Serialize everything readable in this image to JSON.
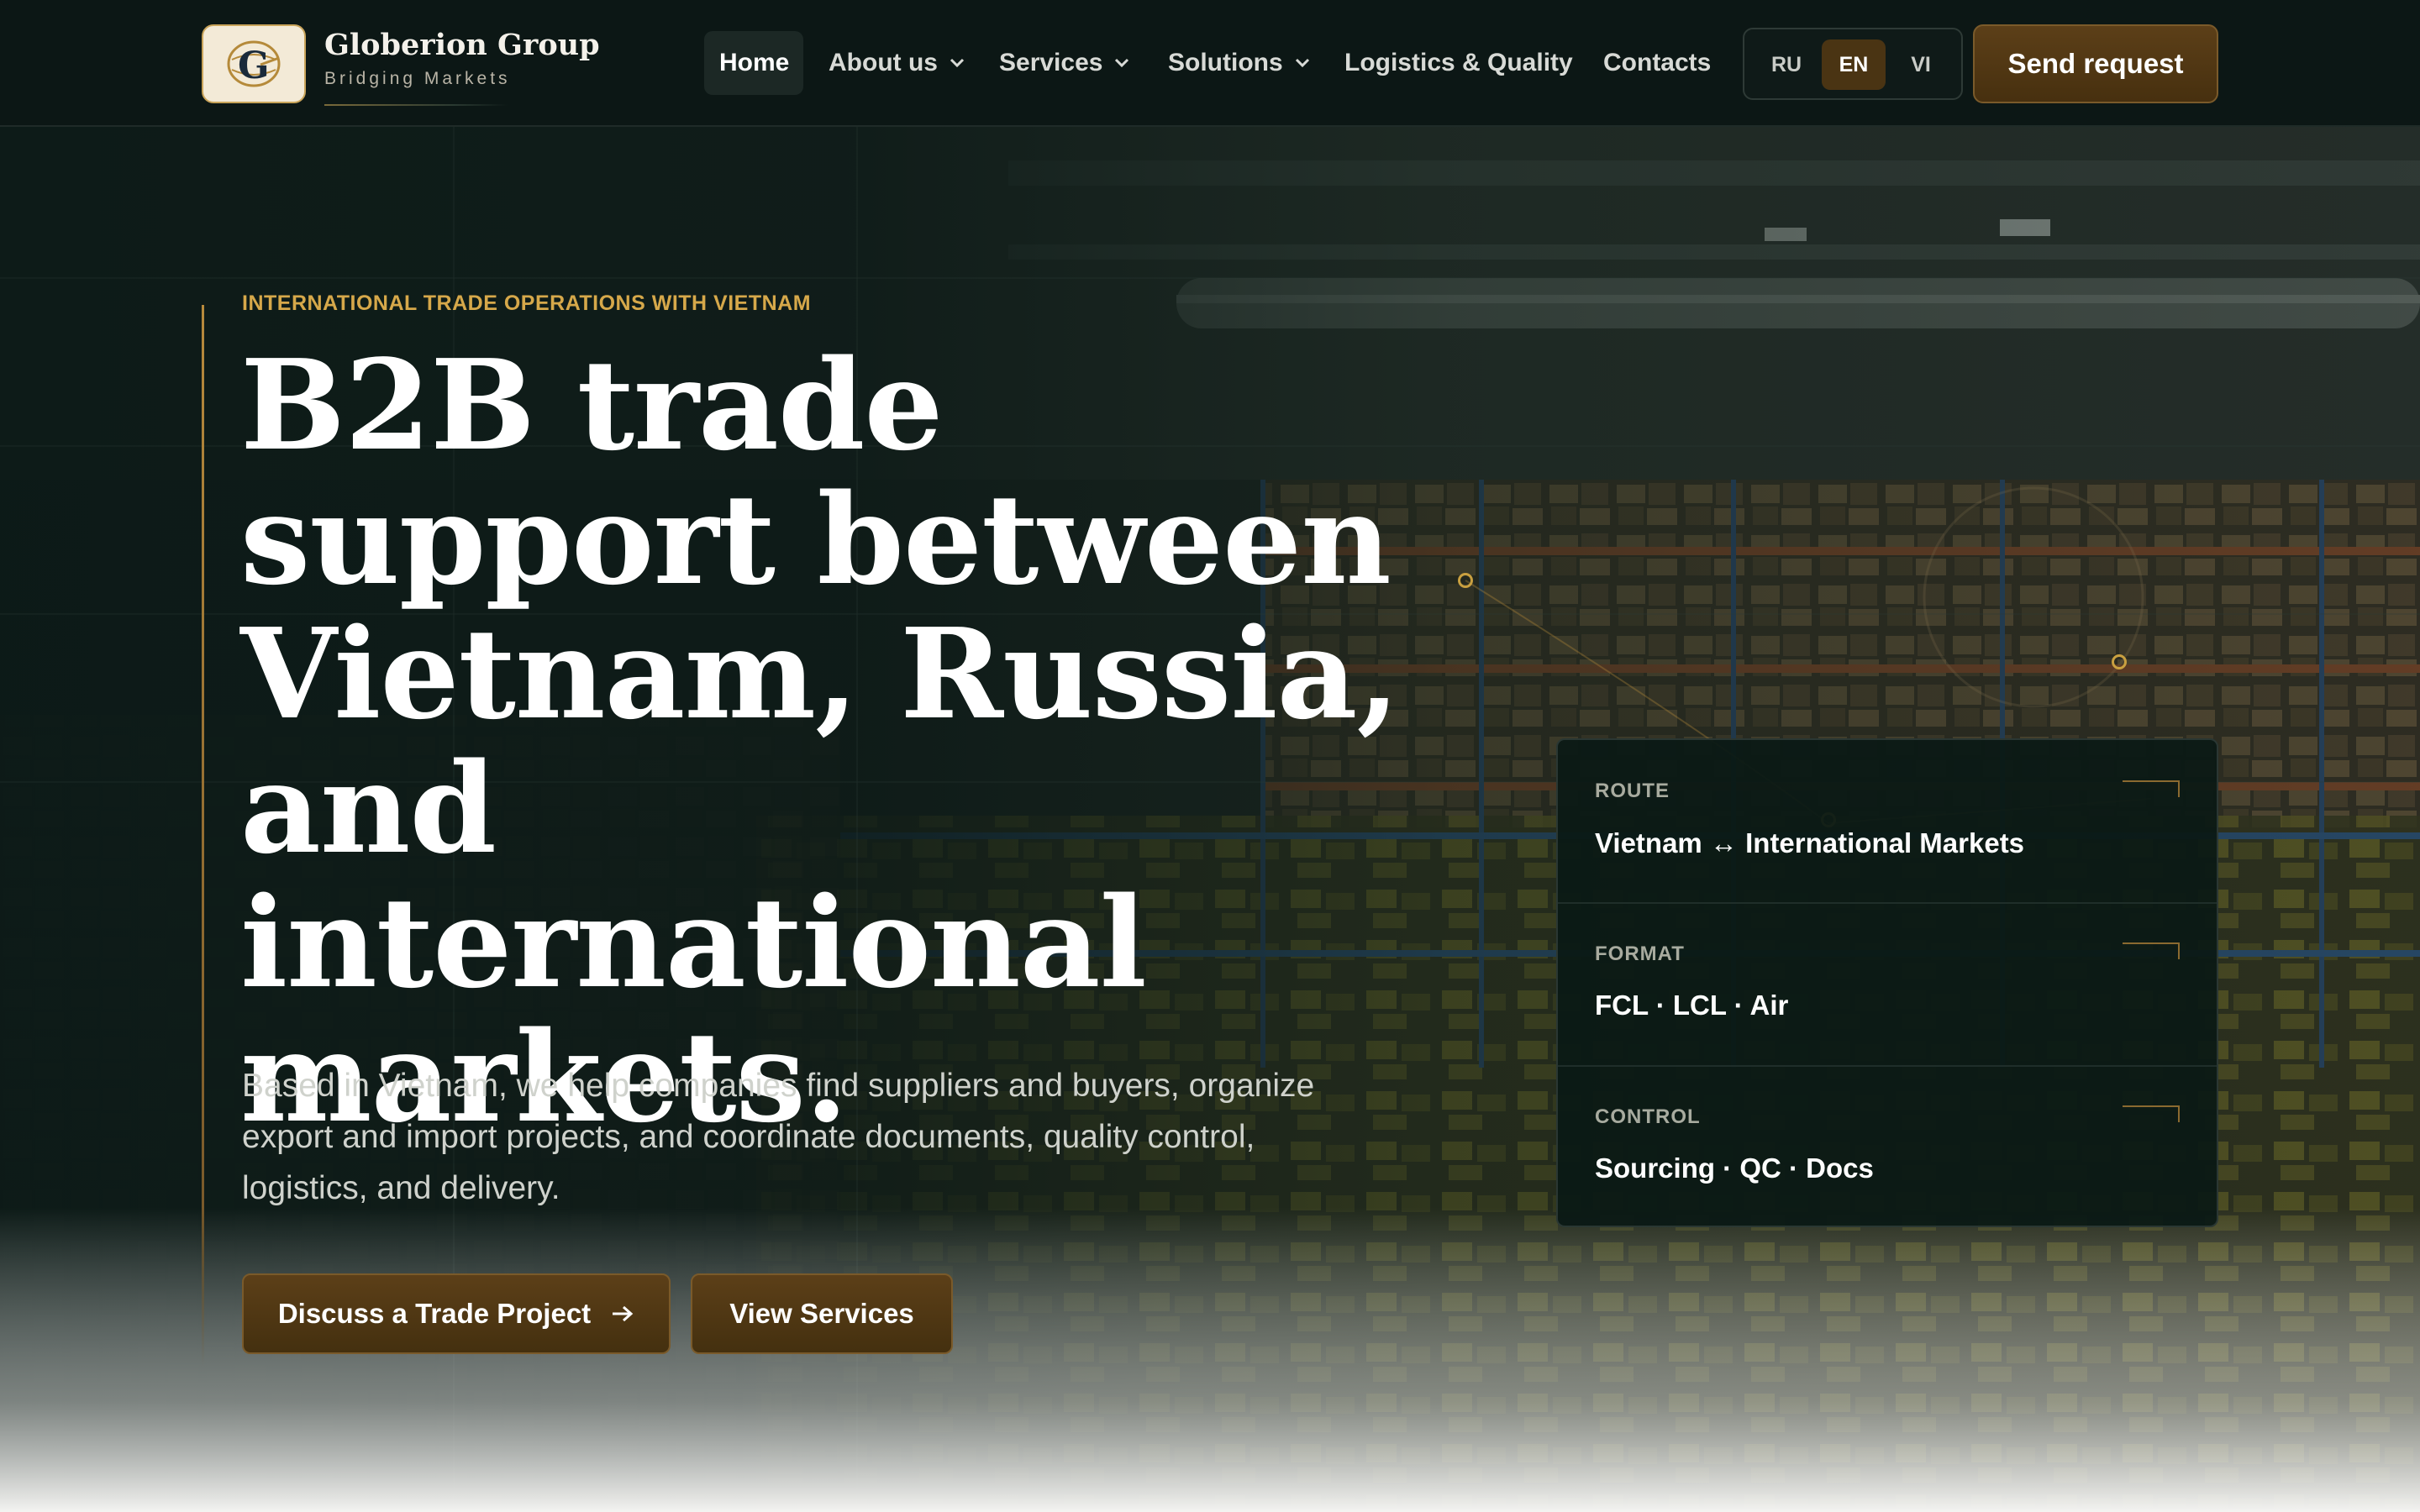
{
  "brand": {
    "name": "Globerion Group",
    "tagline": "Bridging Markets"
  },
  "nav": {
    "items": [
      {
        "label": "Home",
        "active": true,
        "dropdown": false
      },
      {
        "label": "About us",
        "active": false,
        "dropdown": true
      },
      {
        "label": "Services",
        "active": false,
        "dropdown": true
      },
      {
        "label": "Solutions",
        "active": false,
        "dropdown": true
      },
      {
        "label": "Logistics & Quality",
        "active": false,
        "dropdown": false
      },
      {
        "label": "Contacts",
        "active": false,
        "dropdown": false
      }
    ]
  },
  "languages": {
    "options": [
      "RU",
      "EN",
      "VI"
    ],
    "selected": "EN"
  },
  "header": {
    "cta_label": "Send request"
  },
  "hero": {
    "eyebrow": "INTERNATIONAL TRADE OPERATIONS WITH VIETNAM",
    "headline": "B2B trade support between Vietnam, Russia, and international markets.",
    "description": "Based in Vietnam, we help companies find suppliers and buyers, organize export and import projects, and coordinate documents, quality control, logistics, and delivery.",
    "primary_cta": "Discuss a Trade Project",
    "secondary_cta": "View Services"
  },
  "info_card": {
    "rows": [
      {
        "label": "ROUTE",
        "value": "Vietnam ↔ International Markets"
      },
      {
        "label": "FORMAT",
        "value": "FCL · LCL · Air"
      },
      {
        "label": "CONTROL",
        "value": "Sourcing · QC · Docs"
      }
    ]
  },
  "colors": {
    "accent_gold": "#d6a84a",
    "button_brown": "#4a3413",
    "header_bg": "#0c1715",
    "card_bg": "#0b1915"
  },
  "icons": {
    "logo": "globe-g-logo-icon",
    "dropdown": "chevron-down-icon",
    "cta_arrow": "arrow-right-icon"
  }
}
